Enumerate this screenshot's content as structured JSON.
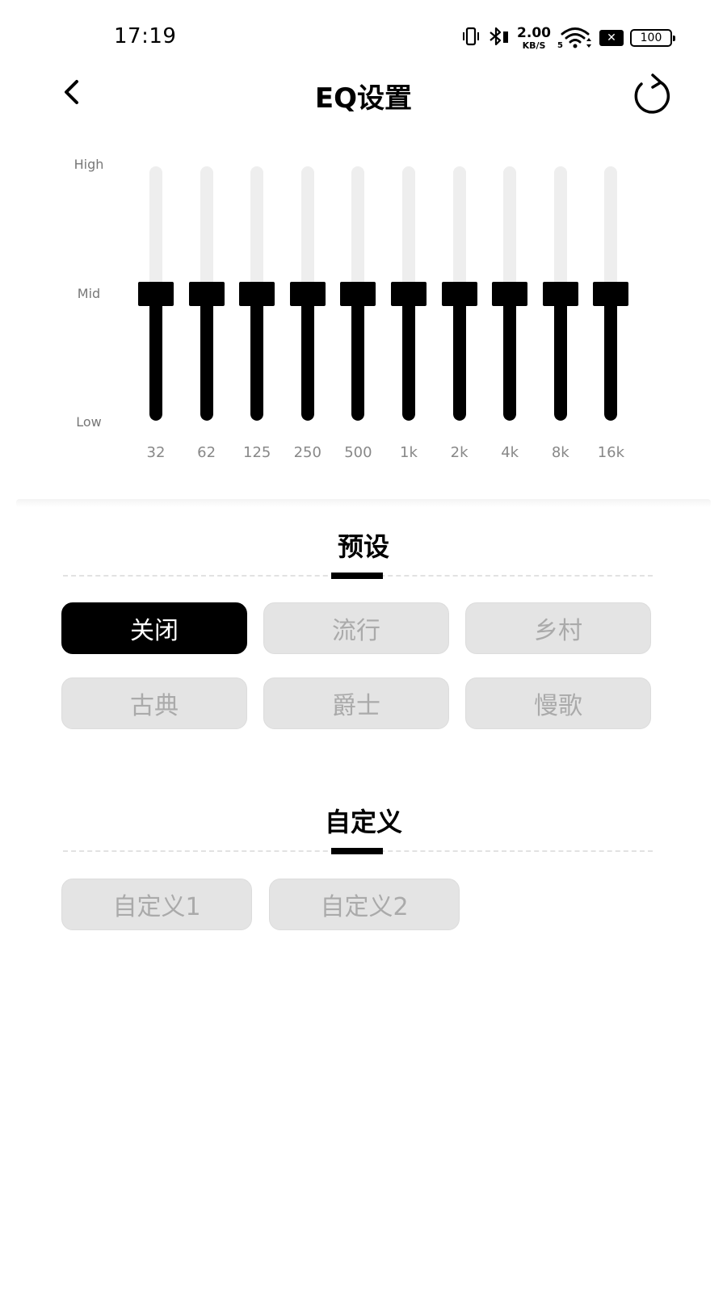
{
  "status": {
    "time": "17:19",
    "net_speed": "2.00",
    "net_unit": "KB/S",
    "wifi_sub": "5",
    "x_badge": "✕",
    "battery": "100"
  },
  "header": {
    "title": "EQ设置"
  },
  "eq": {
    "levels": {
      "high": "High",
      "mid": "Mid",
      "low": "Low"
    },
    "bands": [
      {
        "label": "32",
        "value": 0.5
      },
      {
        "label": "62",
        "value": 0.5
      },
      {
        "label": "125",
        "value": 0.5
      },
      {
        "label": "250",
        "value": 0.5
      },
      {
        "label": "500",
        "value": 0.5
      },
      {
        "label": "1k",
        "value": 0.5
      },
      {
        "label": "2k",
        "value": 0.5
      },
      {
        "label": "4k",
        "value": 0.5
      },
      {
        "label": "8k",
        "value": 0.5
      },
      {
        "label": "16k",
        "value": 0.5
      }
    ]
  },
  "presets": {
    "title": "预设",
    "items": [
      {
        "label": "关闭",
        "active": true
      },
      {
        "label": "流行",
        "active": false
      },
      {
        "label": "乡村",
        "active": false
      },
      {
        "label": "古典",
        "active": false
      },
      {
        "label": "爵士",
        "active": false
      },
      {
        "label": "慢歌",
        "active": false
      }
    ]
  },
  "custom": {
    "title": "自定义",
    "items": [
      {
        "label": "自定义1"
      },
      {
        "label": "自定义2"
      }
    ]
  },
  "colors": {
    "accent": "#000000",
    "chip_bg": "#e4e4e4",
    "chip_text": "#aaaaaa",
    "track": "#eeeeee"
  }
}
